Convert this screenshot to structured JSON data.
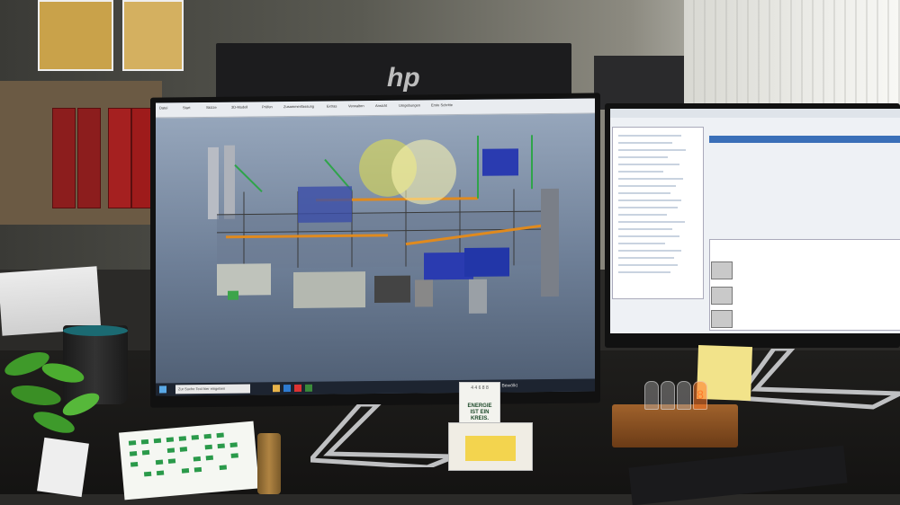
{
  "scene": {
    "description_free": true,
    "back_monitor_brand": "hp"
  },
  "left_monitor": {
    "ribbon_tabs": [
      "Datei",
      "Start",
      "Skizze",
      "3D-Modell",
      "Prüfen",
      "Zusammenfassung",
      "Extras",
      "Verwalten",
      "Ansicht",
      "Umgebungen",
      "Erste Schritte"
    ],
    "taskbar_search_placeholder": "Zur Suche Text hier eingeben",
    "taskbar_status": "17°C Bewölkt"
  },
  "desk_card": {
    "title": "4 4 6 8 8",
    "text_lines": [
      "ENERGIE",
      "IST EIN",
      "KREIS."
    ]
  },
  "nixie_clock": {
    "digits": "8"
  },
  "colors": {
    "ui_accent": "#3a6fb8",
    "plant_blue": "#2a3bb0",
    "plant_orange": "#e08a1e",
    "plant_green": "#2fa44a"
  }
}
